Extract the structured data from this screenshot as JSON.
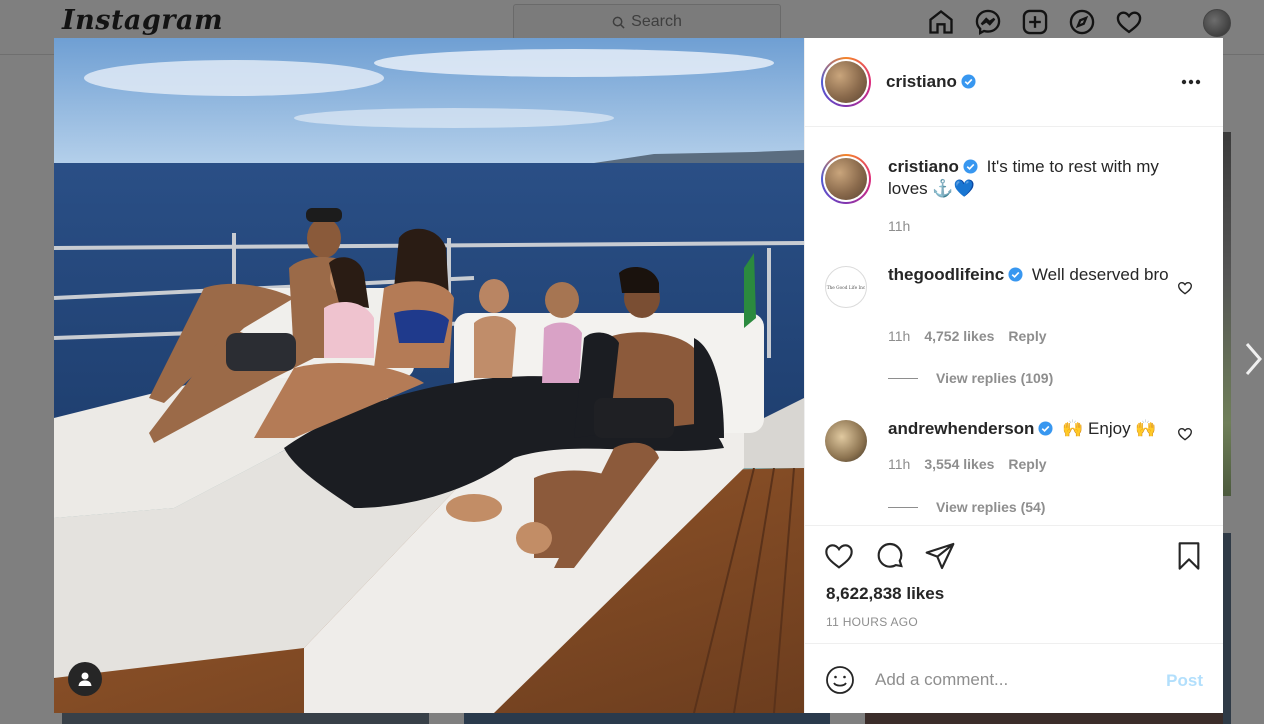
{
  "topnav": {
    "logo": "Instagram",
    "search_placeholder": "Search",
    "icons": [
      "home-icon",
      "messenger-icon",
      "new-post-icon",
      "explore-icon",
      "activity-heart-icon",
      "profile-avatar"
    ]
  },
  "post": {
    "author": "cristiano",
    "caption": "It's time to rest with my loves ⚓️💙",
    "caption_time": "11h",
    "likes": "8,622,838 likes",
    "time_ago": "11 HOURS AGO"
  },
  "comments": [
    {
      "username": "thegoodlifeinc",
      "verified": true,
      "text": "Well deserved bro",
      "time": "11h",
      "likes": "4,752 likes",
      "reply_label": "Reply",
      "view_replies": "View replies (109)"
    },
    {
      "username": "andrewhenderson",
      "verified": true,
      "text": "🙌 Enjoy 🙌",
      "time": "11h",
      "likes": "3,554 likes",
      "reply_label": "Reply",
      "view_replies": "View replies (54)"
    }
  ],
  "add_comment": {
    "placeholder": "Add a comment...",
    "post_label": "Post"
  },
  "colors": {
    "verified_blue": "#3897f0",
    "post_button_disabled": "#b2dffc",
    "muted_text": "#8e8e8e"
  }
}
